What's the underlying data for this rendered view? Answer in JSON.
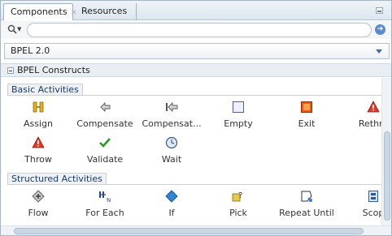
{
  "tabs": [
    {
      "label": "Components",
      "close": "×"
    },
    {
      "label": "Resources"
    }
  ],
  "search": {
    "value": "",
    "placeholder": ""
  },
  "language_select": {
    "value": "BPEL 2.0"
  },
  "section": {
    "title": "BPEL Constructs"
  },
  "groups": {
    "basic": {
      "label": "Basic Activities",
      "items": [
        {
          "label": "Assign",
          "icon": "assign-icon"
        },
        {
          "label": "Compensate",
          "icon": "compensate-icon"
        },
        {
          "label": "Compensat...",
          "icon": "compensate-scope-icon"
        },
        {
          "label": "Empty",
          "icon": "empty-icon"
        },
        {
          "label": "Exit",
          "icon": "exit-icon"
        },
        {
          "label": "Rethro",
          "icon": "rethrow-icon"
        },
        {
          "label": "Throw",
          "icon": "throw-icon"
        },
        {
          "label": "Validate",
          "icon": "validate-icon"
        },
        {
          "label": "Wait",
          "icon": "wait-icon"
        }
      ]
    },
    "structured": {
      "label": "Structured Activities",
      "items": [
        {
          "label": "Flow",
          "icon": "flow-icon"
        },
        {
          "label": "For Each",
          "icon": "for-each-icon"
        },
        {
          "label": "If",
          "icon": "if-icon"
        },
        {
          "label": "Pick",
          "icon": "pick-icon"
        },
        {
          "label": "Repeat Until",
          "icon": "repeat-until-icon"
        },
        {
          "label": "Scop",
          "icon": "scope-icon"
        }
      ]
    }
  }
}
